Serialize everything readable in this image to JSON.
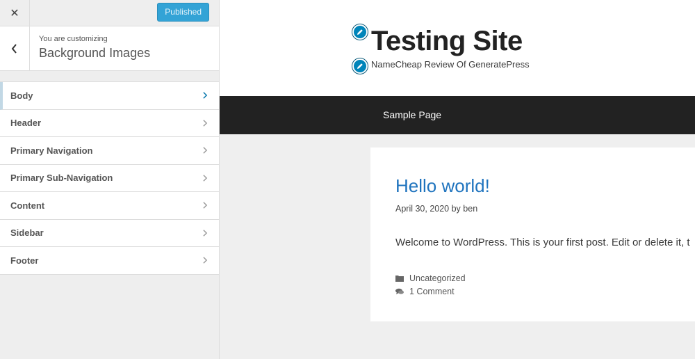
{
  "topbar": {
    "close_symbol": "✕",
    "publish_label": "Published"
  },
  "section": {
    "subtitle": "You are customizing",
    "title": "Background Images"
  },
  "menu": [
    {
      "label": "Body"
    },
    {
      "label": "Header"
    },
    {
      "label": "Primary Navigation"
    },
    {
      "label": "Primary Sub-Navigation"
    },
    {
      "label": "Content"
    },
    {
      "label": "Sidebar"
    },
    {
      "label": "Footer"
    }
  ],
  "site": {
    "title": "Testing Site",
    "tagline": "NameCheap Review Of GeneratePress",
    "nav_link": "Sample Page"
  },
  "post": {
    "title": "Hello world!",
    "meta": "April 30, 2020 by ben",
    "body": "Welcome to WordPress. This is your first post. Edit or delete it, t",
    "category": "Uncategorized",
    "comments": "1 Comment"
  },
  "icons": {
    "close": "close-icon",
    "back": "chevron-left-icon",
    "menu_arrow": "chevron-right-icon",
    "edit": "pencil-icon",
    "folder": "folder-icon",
    "comment": "comments-icon"
  },
  "colors": {
    "accent": "#0085ba",
    "publish": "#33a3d6",
    "link": "#1e73be",
    "nav_bg": "#222222"
  }
}
